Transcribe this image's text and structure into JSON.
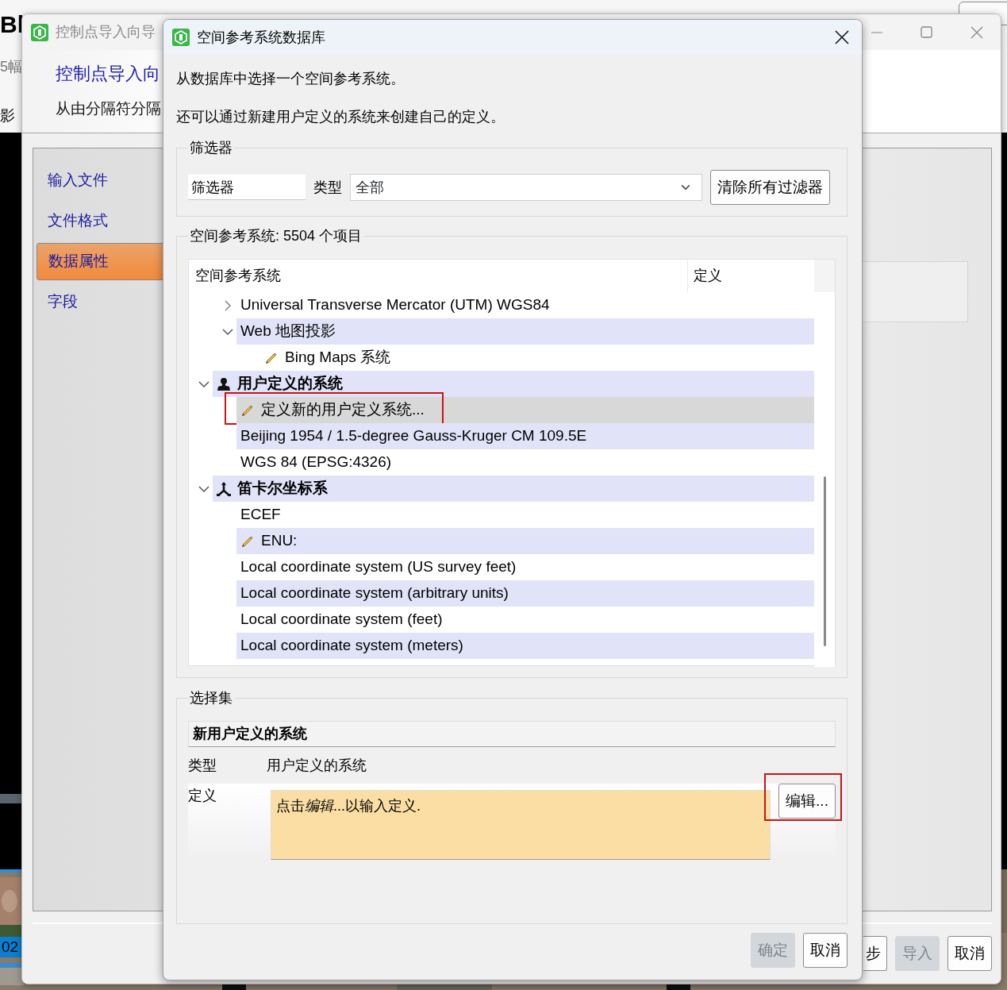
{
  "background_app": {
    "title_fragment": "Bl",
    "count_fragment": "5幅",
    "label_fragment": "影",
    "tile_label": "02"
  },
  "wizard": {
    "title": "控制点导入向导",
    "heading": "控制点导入向",
    "subheading": "从由分隔符分隔",
    "steps": [
      {
        "label": "输入文件",
        "selected": false
      },
      {
        "label": "文件格式",
        "selected": false
      },
      {
        "label": "数据属性",
        "selected": true
      },
      {
        "label": "字段",
        "selected": false
      }
    ],
    "buttons": [
      {
        "label": "步",
        "disabled": false
      },
      {
        "label": "导入",
        "disabled": true
      },
      {
        "label": "取消",
        "disabled": false
      }
    ]
  },
  "dialog": {
    "title": "空间参考系统数据库",
    "intro": [
      "从数据库中选择一个空间参考系统。",
      "还可以通过新建用户定义的系统来创建自己的定义。"
    ],
    "filter": {
      "legend": "筛选器",
      "value": "筛选器",
      "type_label": "类型",
      "type_value": "全部",
      "clear_button": "清除所有过滤器"
    },
    "systems": {
      "legend": "空间参考系统: 5504 个项目",
      "columns": [
        "空间参考系统",
        "定义"
      ],
      "tree": [
        {
          "children": [
            {
              "label": "Universal Transverse Mercator (UTM) WGS84",
              "kind": "plain",
              "expanded": false,
              "selected": false,
              "annotated": false
            },
            {
              "label": "Web 地图投影",
              "kind": "plain",
              "expanded": true,
              "selected": false,
              "annotated": false,
              "children": [
                {
                  "label": "Bing Maps 系统",
                  "kind": "editable",
                  "selected": false,
                  "annotated": false
                }
              ]
            }
          ]
        },
        {
          "label": "用户定义的系统",
          "kind": "user",
          "expanded": true,
          "selected": false,
          "annotated": false,
          "children": [
            {
              "label": "定义新的用户定义系统...",
              "kind": "editable",
              "selected": true,
              "annotated": true
            },
            {
              "label": "Beijing 1954 / 1.5-degree Gauss-Kruger CM 109.5E",
              "kind": "plain",
              "selected": false,
              "annotated": false
            },
            {
              "label": "WGS 84 (EPSG:4326)",
              "kind": "plain",
              "selected": false,
              "annotated": false
            }
          ]
        },
        {
          "label": "笛卡尔坐标系",
          "kind": "cartesian",
          "expanded": true,
          "selected": false,
          "annotated": false,
          "children": [
            {
              "label": "ECEF",
              "kind": "plain",
              "selected": false,
              "annotated": false
            },
            {
              "label": "ENU:",
              "kind": "editable",
              "selected": false,
              "annotated": false
            },
            {
              "label": "Local coordinate system (US survey feet)",
              "kind": "plain",
              "selected": false,
              "annotated": false
            },
            {
              "label": "Local coordinate system (arbitrary units)",
              "kind": "plain",
              "selected": false,
              "annotated": false
            },
            {
              "label": "Local coordinate system (feet)",
              "kind": "plain",
              "selected": false,
              "annotated": false
            },
            {
              "label": "Local coordinate system (meters)",
              "kind": "plain",
              "selected": false,
              "annotated": false
            }
          ]
        }
      ]
    },
    "selection": {
      "legend": "选择集",
      "name": "新用户定义的系统",
      "type_label": "类型",
      "type_value": "用户定义的系统",
      "definition_label": "定义",
      "definition_text": [
        {
          "text": "点击",
          "kind": "plain"
        },
        {
          "text": "编辑",
          "kind": "italic"
        },
        {
          "text": "...以输入定义.",
          "kind": "plain"
        }
      ],
      "edit_button": {
        "label": "编辑...",
        "annotated": true
      }
    },
    "buttons": [
      {
        "label": "确定",
        "disabled": true
      },
      {
        "label": "取消",
        "disabled": false
      }
    ]
  }
}
